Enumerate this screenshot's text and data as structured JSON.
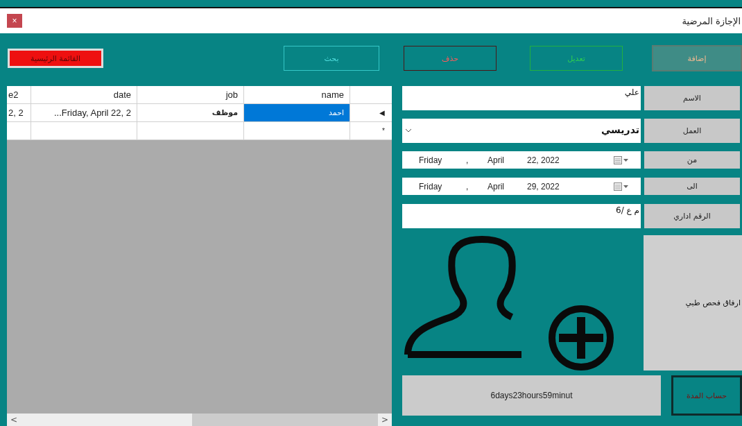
{
  "window": {
    "title": "الإجازة المرضية",
    "close": "×"
  },
  "toolbar": [
    {
      "label": "إضافة",
      "kind": "add"
    },
    {
      "label": "تعديل",
      "kind": "edit"
    },
    {
      "label": "حذف",
      "kind": "delete"
    },
    {
      "label": "بحث",
      "kind": "search"
    },
    {
      "label": "القائمة الرئيسية",
      "kind": "menu"
    }
  ],
  "grid": {
    "columns": [
      "name",
      "job",
      "date",
      "e2"
    ],
    "rows": [
      {
        "indicator": "◀",
        "selected": true,
        "cells": [
          "احمد",
          "موظف",
          "...Friday, April 22, 2",
          "2, 2"
        ]
      }
    ],
    "new_row": {
      "indicator": "*"
    },
    "scroll": {
      "left": "<",
      "right": ">"
    }
  },
  "form": {
    "fields": [
      {
        "label": "الاسم",
        "kind": "text",
        "value": "علي"
      },
      {
        "label": "العمل",
        "kind": "combo",
        "value": "تدريسي"
      },
      {
        "label": "من",
        "kind": "date",
        "day": "Friday",
        "separator": ",",
        "month": "April",
        "date": "22, 2022"
      },
      {
        "label": "الى",
        "kind": "date",
        "day": "Friday",
        "separator": ",",
        "month": "April",
        "date": "29, 2022"
      },
      {
        "label": "الرقم اداري",
        "kind": "text",
        "value": "م ع /6"
      }
    ],
    "attach_button": "ارفاق فحص طبي",
    "duration": "6days23hours59minut",
    "calc_button": "حساب المدة"
  }
}
